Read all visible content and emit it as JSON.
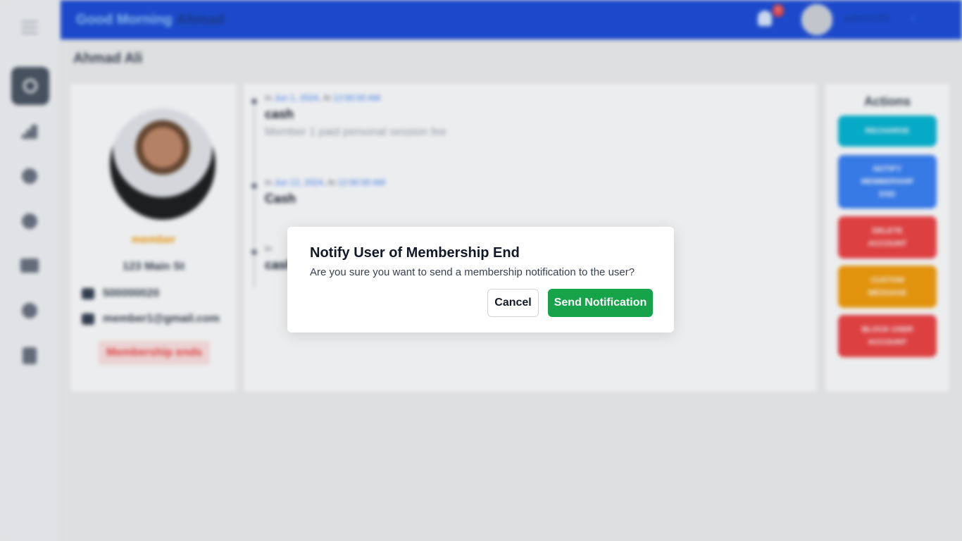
{
  "header": {
    "greeting": "Good Morning",
    "greeting_name": "Ahmad",
    "notification_count": "0",
    "username": "admin33"
  },
  "page": {
    "title": "Ahmad Ali"
  },
  "profile": {
    "role": "member",
    "address": "123 Main St",
    "phone": "500000020",
    "email": "member1@gmail.com",
    "status_badge": "Membership ends"
  },
  "timeline": [
    {
      "prefix": "In",
      "date": "Jun 1, 2024,",
      "at": "At",
      "time": "12:00:00 AM",
      "title": "cash",
      "description": "Member 1 paid personal session fee"
    },
    {
      "prefix": "In",
      "date": "Jun 12, 2024,",
      "at": "At",
      "time": "12:00:00 AM",
      "title": "Cash",
      "description": ""
    },
    {
      "prefix": "In",
      "date": "",
      "at": "",
      "time": "",
      "title": "cash",
      "description": ""
    }
  ],
  "actions": {
    "title": "Actions",
    "buttons": [
      {
        "label": "RECHARGE",
        "color": "#06b6d4"
      },
      {
        "label": "NOTIFY MEMBERSHIP END",
        "color": "#3b82f6"
      },
      {
        "label": "DELETE ACCOUNT",
        "color": "#ef4444"
      },
      {
        "label": "CUSTOM MESSAGE",
        "color": "#f59e0b"
      },
      {
        "label": "BLOCK USER ACCOUNT",
        "color": "#ef4444"
      }
    ]
  },
  "modal": {
    "title": "Notify User of Membership End",
    "body": "Are you sure you want to send a membership notification to the user?",
    "cancel_label": "Cancel",
    "confirm_label": "Send Notification",
    "confirm_color": "#16a34a"
  },
  "sidebar": {
    "icons": [
      "search-icon",
      "chart-bars-icon",
      "globe-icon",
      "user-icon",
      "screen-icon",
      "gear-icon",
      "document-icon"
    ]
  }
}
